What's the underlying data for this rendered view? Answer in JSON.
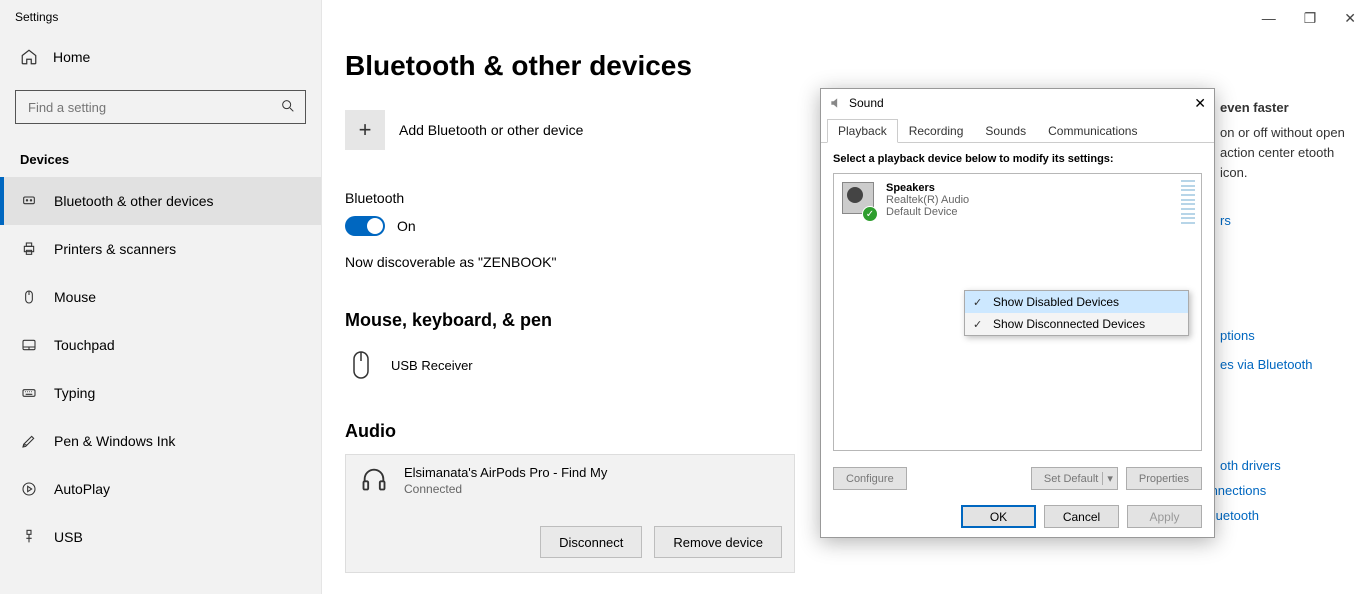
{
  "app_title": "Settings",
  "home_label": "Home",
  "search_placeholder": "Find a setting",
  "category_title": "Devices",
  "nav": [
    {
      "label": "Bluetooth & other devices"
    },
    {
      "label": "Printers & scanners"
    },
    {
      "label": "Mouse"
    },
    {
      "label": "Touchpad"
    },
    {
      "label": "Typing"
    },
    {
      "label": "Pen & Windows Ink"
    },
    {
      "label": "AutoPlay"
    },
    {
      "label": "USB"
    }
  ],
  "page_title": "Bluetooth & other devices",
  "add_device_label": "Add Bluetooth or other device",
  "bluetooth_label": "Bluetooth",
  "toggle_label": "On",
  "discoverable_text": "Now discoverable as \"ZENBOOK\"",
  "sections": {
    "mouse_title": "Mouse, keyboard, & pen",
    "usb_receiver": "USB Receiver",
    "audio_title": "Audio",
    "audio_device": "Elsimanata's AirPods Pro - Find My",
    "audio_status": "Connected",
    "disconnect": "Disconnect",
    "remove": "Remove device"
  },
  "hints": {
    "head1": "even faster",
    "para": "on or off without open action center etooth icon.",
    "link_rs": "rs",
    "link_options": "ptions",
    "link_via": "es via Bluetooth",
    "link_drivers": "oth drivers",
    "link_fix": "Fixing Bluetooth connections",
    "link_share": "Sharing files over Bluetooth"
  },
  "sound": {
    "title": "Sound",
    "tabs": [
      "Playback",
      "Recording",
      "Sounds",
      "Communications"
    ],
    "hint": "Select a playback device below to modify its settings:",
    "device": {
      "name": "Speakers",
      "driver": "Realtek(R) Audio",
      "status": "Default Device"
    },
    "ctx": [
      "Show Disabled Devices",
      "Show Disconnected Devices"
    ],
    "configure": "Configure",
    "set_default": "Set Default",
    "properties": "Properties",
    "ok": "OK",
    "cancel": "Cancel",
    "apply": "Apply"
  }
}
